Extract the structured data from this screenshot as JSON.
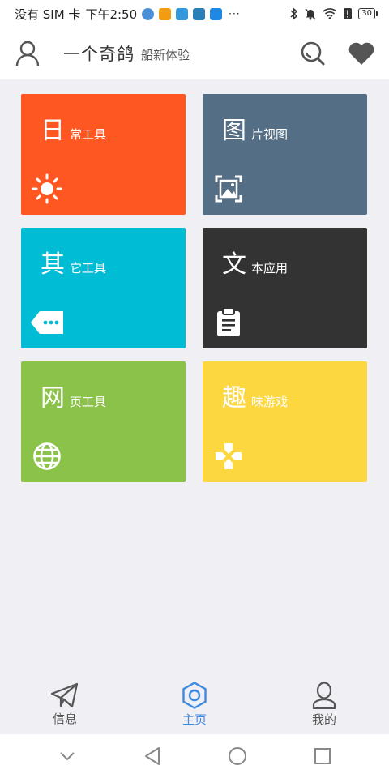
{
  "status_bar": {
    "carrier": "没有 SIM 卡",
    "time": "下午2:50",
    "more": "···",
    "battery": "30"
  },
  "header": {
    "title": "一个奇鸽",
    "subtitle": "船新体验",
    "user_icon": "user-icon",
    "search_icon": "search-icon",
    "heart_icon": "heart-icon"
  },
  "tiles": [
    {
      "big": "日",
      "small": "常工具",
      "color": "#ff5722",
      "icon": "sun-icon"
    },
    {
      "big": "图",
      "small": "片视图",
      "color": "#546e85",
      "icon": "image-icon"
    },
    {
      "big": "其",
      "small": "它工具",
      "color": "#00bcd4",
      "icon": "tag-dots-icon"
    },
    {
      "big": "文",
      "small": "本应用",
      "color": "#333333",
      "icon": "clipboard-icon"
    },
    {
      "big": "网",
      "small": "页工具",
      "color": "#8bc34a",
      "icon": "globe-icon"
    },
    {
      "big": "趣",
      "small": "味游戏",
      "color": "#fdd740",
      "icon": "gamepad-icon"
    }
  ],
  "bottom_nav": [
    {
      "label": "信息",
      "icon": "paper-plane-icon",
      "active": false
    },
    {
      "label": "主页",
      "icon": "hexagon-icon",
      "active": true
    },
    {
      "label": "我的",
      "icon": "profile-icon",
      "active": false
    }
  ],
  "colors": {
    "accent": "#3d8be0",
    "background": "#efeff4",
    "header_icon": "#555555"
  }
}
